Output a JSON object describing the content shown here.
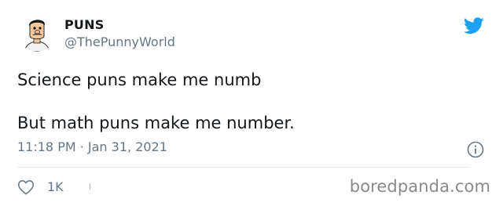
{
  "author": {
    "display_name": "PUNS",
    "handle": "@ThePunnyWorld"
  },
  "tweet": {
    "lines": [
      "Science puns make me numb",
      "But math puns make me number."
    ],
    "timestamp": "11:18 PM · Jan 31, 2021"
  },
  "actions": {
    "like_count": "1K"
  },
  "watermark": "boredpanda.com",
  "colors": {
    "text": "#14171a",
    "secondary": "#657786",
    "twitter_blue": "#1da1f2",
    "divider": "#e1e8ed"
  },
  "icons": {
    "brand": "twitter-bird-icon",
    "info": "info-icon",
    "like": "heart-icon"
  }
}
